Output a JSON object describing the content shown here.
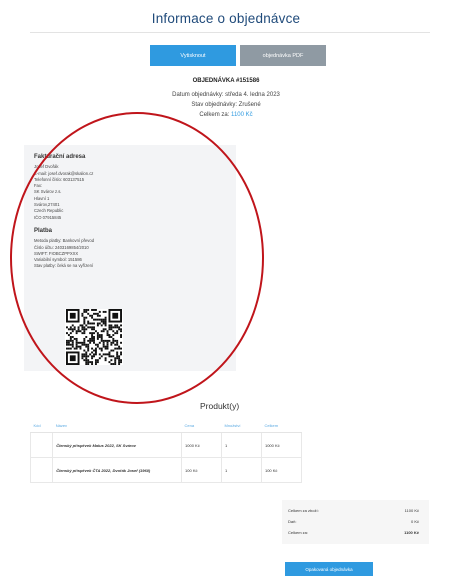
{
  "header": {
    "title": "Informace o objednávce"
  },
  "actions": {
    "print_label": "Vytisknout",
    "pdf_label": "objednávka PDF"
  },
  "order": {
    "number_label": "OBJEDNÁVKA #151586",
    "date_line": "Datum objednávky: středa 4. ledna 2023",
    "status_line": "Stav objednávky: Zrušené",
    "total_label": "Celkem za:",
    "total_value": "1100 Kč"
  },
  "billing": {
    "heading": "Fakturační adresa",
    "lines": [
      "Josef Dvořák",
      "E-mail: josef.dvorak@skalion.cz",
      "Telefonní číslo: 603137515",
      "Fax:",
      "SK Svárov z.s.",
      "Hlavní 1",
      "Svárov,27401",
      "Czech Republic",
      "IČO 07915845"
    ]
  },
  "payment": {
    "heading": "Platba",
    "lines": [
      "Metoda platby: Bankovní převod",
      "Číslo účtu: 2403169854/2010",
      "SWIFT: FIOBCZPPXXX",
      "Variabilní symbol: 151586",
      "Stav platby: čeká se na vyřízení"
    ]
  },
  "products": {
    "title": "Produkt(y)",
    "columns": [
      "Kód",
      "Název",
      "Cena",
      "Množství",
      "Celkem"
    ],
    "rows": [
      {
        "code": "",
        "name": "Členský příspěvek Malus 2022, SK Svárov",
        "price": "1000 Kč",
        "qty": "1",
        "total": "1000 Kč"
      },
      {
        "code": "",
        "name": "Členský příspěvek ČTA 2022, Dvořák Josef (1960)",
        "price": "100 Kč",
        "qty": "1",
        "total": "100 Kč"
      }
    ]
  },
  "summary": {
    "subtotal_label": "Celkem za zboží:",
    "subtotal_value": "1100 Kč",
    "tax_label": "Daň:",
    "tax_value": "0 Kč",
    "total_label": "Celkem za:",
    "total_value": "1100 Kč"
  },
  "reorder": {
    "label": "Opakovaná objednávka"
  },
  "colors": {
    "accent": "#2f9ae0",
    "title": "#1f4a7a",
    "annotation": "#c0151b",
    "pdf_button": "#8f9aa3"
  }
}
